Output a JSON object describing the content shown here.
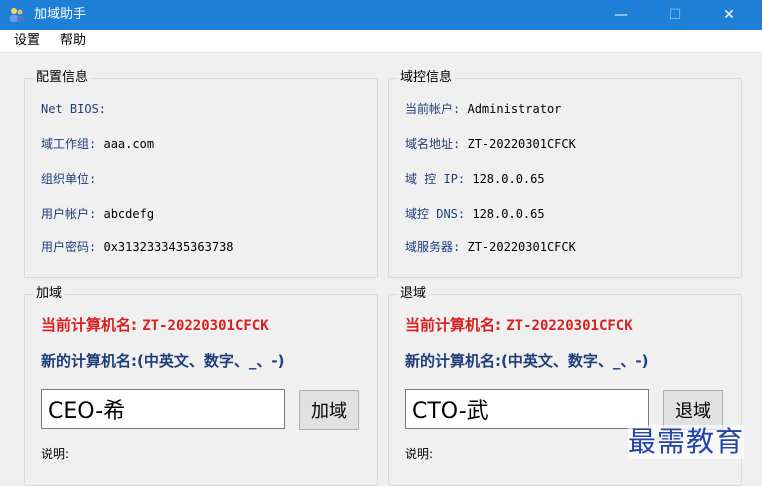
{
  "window": {
    "title": "加域助手",
    "controls": {
      "minimize": "—",
      "maximize": "☐",
      "close": "✕"
    }
  },
  "menu": {
    "items": [
      "设置",
      "帮助"
    ]
  },
  "config_info": {
    "title": "配置信息",
    "rows": [
      {
        "label": "Net BIOS:",
        "value": ""
      },
      {
        "label": "域工作组:",
        "value": "aaa.com"
      },
      {
        "label": "组织单位:",
        "value": ""
      },
      {
        "label": "用户帐户:",
        "value": "abcdefg"
      },
      {
        "label": "用户密码:",
        "value": "0x3132333435363738"
      }
    ]
  },
  "dc_info": {
    "title": "域控信息",
    "rows": [
      {
        "label": "当前帐户:",
        "value": "Administrator"
      },
      {
        "label": "域名地址:",
        "value": "ZT-20220301CFCK"
      },
      {
        "label": "域 控 IP:",
        "value": "128.0.0.65"
      },
      {
        "label": "域控 DNS:",
        "value": "128.0.0.65"
      },
      {
        "label": "域服务器:",
        "value": "ZT-20220301CFCK"
      }
    ]
  },
  "join_domain": {
    "title": "加域",
    "current_label": "当前计算机名:",
    "current_value": "ZT-20220301CFCK",
    "new_label": "新的计算机名:(中英文、数字、_、-)",
    "input_value": "CEO-希",
    "button_label": "加域",
    "note_label": "说明:"
  },
  "leave_domain": {
    "title": "退域",
    "current_label": "当前计算机名:",
    "current_value": "ZT-20220301CFCK",
    "new_label": "新的计算机名:(中英文、数字、_、-)",
    "input_value": "CTO-武",
    "button_label": "退域",
    "note_label": "说明:"
  },
  "watermark": "最需教育",
  "colors": {
    "titlebar": "#1e7fd6",
    "label_blue": "#1f3d7a",
    "red": "#d92020",
    "background": "#f0f0f0"
  }
}
